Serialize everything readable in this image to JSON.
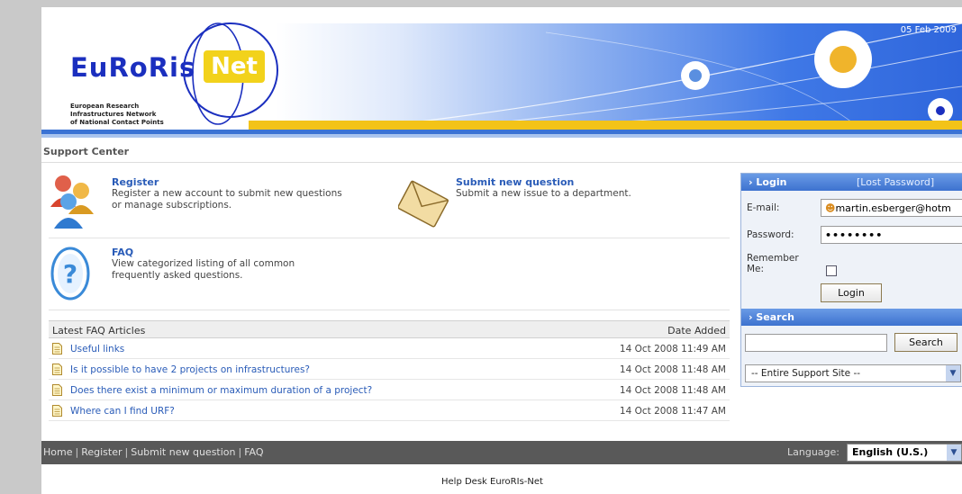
{
  "header": {
    "logo_main": "EuRoRis",
    "logo_net": "Net",
    "logo_subtitle_1": "European Research",
    "logo_subtitle_2": "Infrastructures Network",
    "logo_subtitle_3": "of National Contact Points",
    "date": "05 Feb 2009"
  },
  "support_center": {
    "title": "Support Center"
  },
  "options": {
    "register": {
      "title": "Register",
      "desc_1": "Register a new account to submit new questions",
      "desc_2": "or manage subscriptions."
    },
    "submit": {
      "title": "Submit new question",
      "desc_1": "Submit a new issue to a department."
    },
    "faq": {
      "title": "FAQ",
      "desc_1": "View categorized listing of all common",
      "desc_2": "frequently asked questions."
    }
  },
  "faq_table": {
    "col_article": "Latest FAQ Articles",
    "col_date": "Date Added",
    "rows": [
      {
        "title": "Useful links",
        "date": "14 Oct 2008 11:49 AM"
      },
      {
        "title": "Is it possible to have 2 projects on infrastructures?",
        "date": "14 Oct 2008 11:48 AM"
      },
      {
        "title": "Does there exist a minimum or maximum duration of a project?",
        "date": "14 Oct 2008 11:48 AM"
      },
      {
        "title": "Where can I find URF?",
        "date": "14 Oct 2008 11:47 AM"
      }
    ]
  },
  "login": {
    "title": "Login",
    "lost_password": "[Lost Password]",
    "email_label": "E-mail:",
    "email_value": "martin.esberger@hotm",
    "password_label": "Password:",
    "password_value": "••••••••",
    "remember_label_1": "Remember",
    "remember_label_2": "Me:",
    "login_button": "Login"
  },
  "search": {
    "title": "Search",
    "button": "Search",
    "scope_selected": "-- Entire Support Site --"
  },
  "footer": {
    "nav": [
      "Home",
      "Register",
      "Submit new question",
      "FAQ"
    ],
    "language_label": "Language:",
    "language_selected": "English (U.S.)",
    "help_desk": "Help Desk EuroRIs-Net"
  },
  "colors": {
    "accent_blue": "#3b73d4",
    "accent_yellow": "#f3c318",
    "link": "#2a5cb8",
    "footer_bg": "#595959"
  }
}
